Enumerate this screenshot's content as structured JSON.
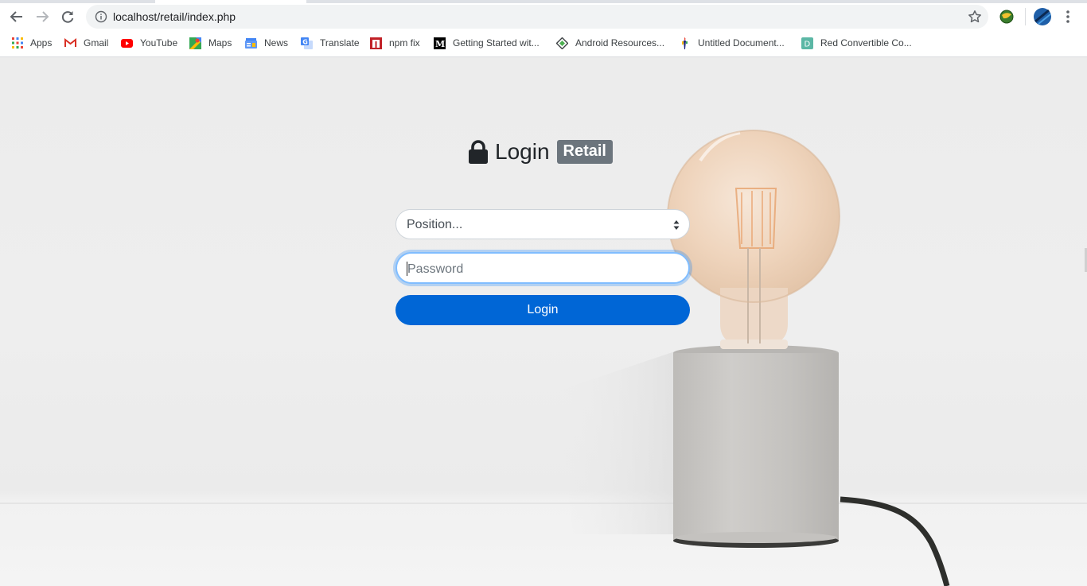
{
  "browser": {
    "url": "localhost/retail/index.php",
    "bookmarks": [
      {
        "label": "Apps",
        "icon": "apps-grid-icon"
      },
      {
        "label": "Gmail",
        "icon": "gmail-icon"
      },
      {
        "label": "YouTube",
        "icon": "youtube-icon"
      },
      {
        "label": "Maps",
        "icon": "maps-icon"
      },
      {
        "label": "News",
        "icon": "news-icon"
      },
      {
        "label": "Translate",
        "icon": "translate-icon"
      },
      {
        "label": "npm fix",
        "icon": "npm-icon"
      },
      {
        "label": "Getting Started wit...",
        "icon": "medium-icon"
      },
      {
        "label": "Android Resources...",
        "icon": "android-resources-icon"
      },
      {
        "label": "Untitled Document...",
        "icon": "document-icon"
      },
      {
        "label": "Red Convertible Co...",
        "icon": "bookmark-d-icon"
      }
    ]
  },
  "login": {
    "title": "Login",
    "badge": "Retail",
    "position_select": {
      "selected": "Position..."
    },
    "password": {
      "placeholder": "Password",
      "value": ""
    },
    "submit_label": "Login"
  },
  "colors": {
    "primary_button": "#0066d6",
    "badge_bg": "#6c757d",
    "focus_ring": "#80bdff"
  }
}
